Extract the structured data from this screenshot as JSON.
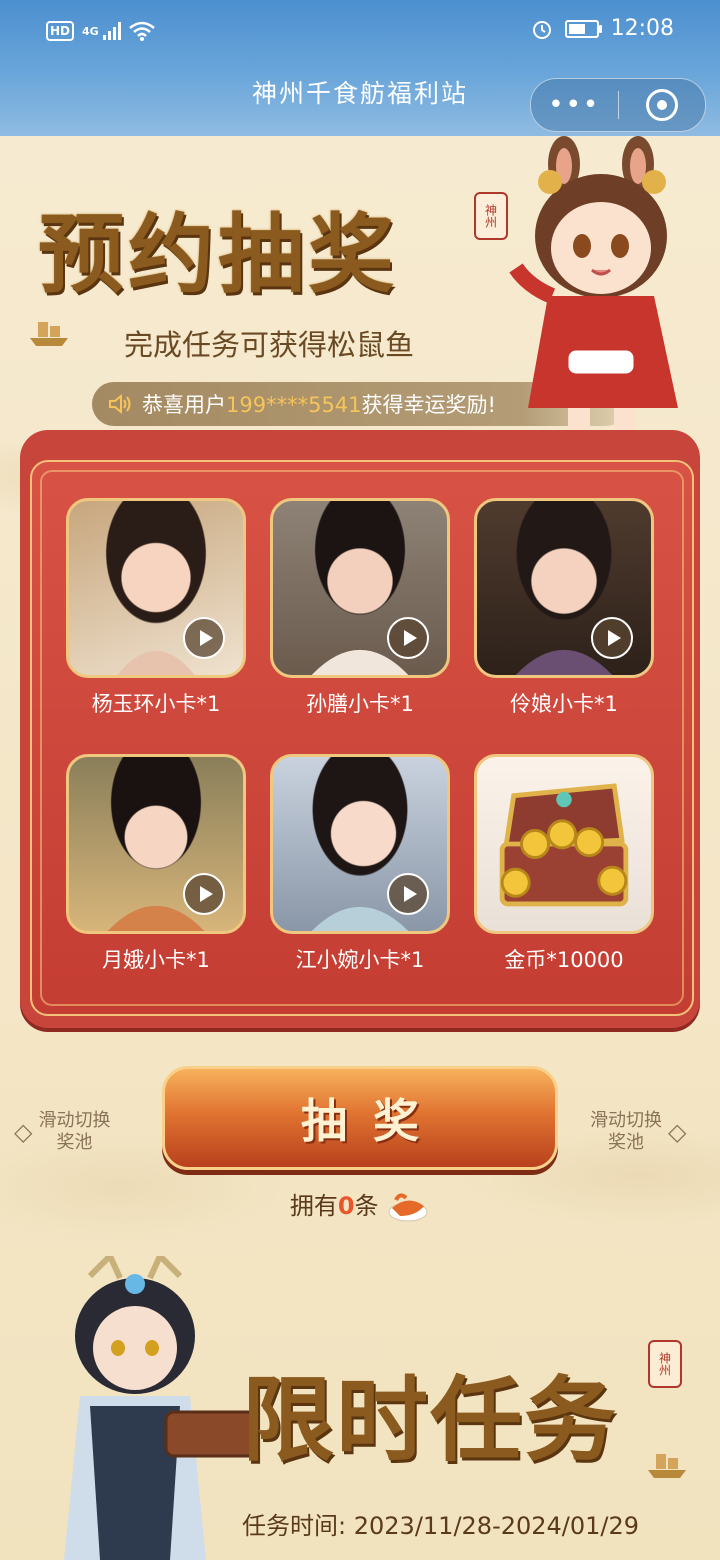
{
  "status_bar": {
    "hd": "HD",
    "network": "4G",
    "time": "12:08"
  },
  "header": {
    "title": "神州千食舫福利站",
    "more_label": "•••"
  },
  "lottery": {
    "title": "预约抽奖",
    "subtitle": "完成任务可获得松鼠鱼",
    "seal_text": "神州",
    "notice": {
      "prefix": "恭喜用户",
      "user": "199****5541",
      "suffix": "获得幸运奖励!"
    },
    "prizes": [
      {
        "name": "杨玉环小卡*1",
        "has_video": true
      },
      {
        "name": "孙膳小卡*1",
        "has_video": true
      },
      {
        "name": "伶娘小卡*1",
        "has_video": true
      },
      {
        "name": "月娥小卡*1",
        "has_video": true
      },
      {
        "name": "江小婉小卡*1",
        "has_video": true
      },
      {
        "name": "金币*10000",
        "has_video": false
      }
    ],
    "draw_button": "抽奖",
    "swipe_left": [
      "滑动切换",
      "奖池"
    ],
    "swipe_right": [
      "滑动切换",
      "奖池"
    ],
    "owned_prefix": "拥有",
    "owned_count": "0",
    "owned_suffix": "条"
  },
  "tasks": {
    "title": "限时任务",
    "seal_text": "神州",
    "time_label": "任务时间:",
    "time_range": "2023/11/28-2024/01/29"
  },
  "colors": {
    "header_blue": "#5b9ad4",
    "panel_red": "#c8453b",
    "gold": "#f0c77e",
    "button_orange": "#e07431",
    "count_orange": "#e8562b"
  }
}
